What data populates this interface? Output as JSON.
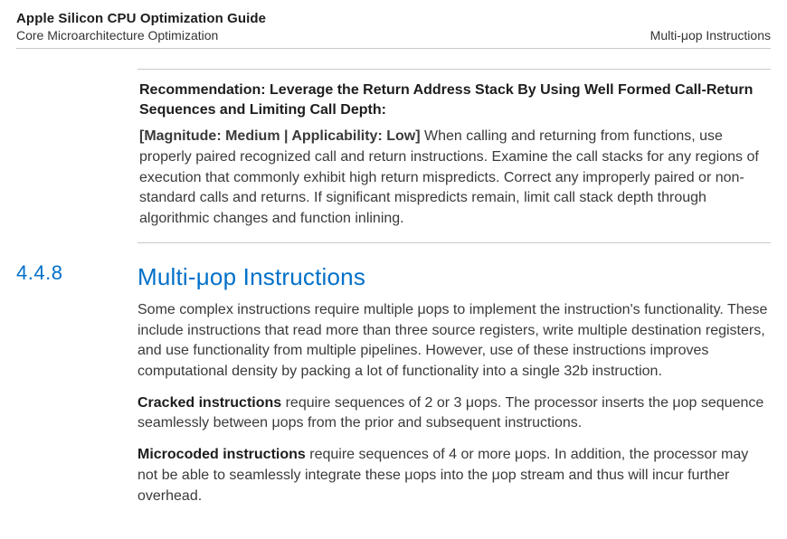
{
  "header": {
    "doc_title": "Apple Silicon CPU Optimization Guide",
    "left_crumb": "Core Microarchitecture Optimization",
    "right_crumb": "Multi-μop Instructions"
  },
  "callout": {
    "label": "Recommendation: ",
    "title": "Leverage the Return Address Stack By Using Well Formed Call-Return Sequences and Limiting Call Depth:",
    "tag": "[Magnitude: Medium | Applicability: Low]",
    "body": " When calling and returning from functions, use properly paired recognized call and return instructions. Examine the call stacks for any regions of execution that commonly exhibit high return mispredicts. Correct any improperly paired or non-standard calls and returns. If significant mispredicts remain, limit call stack depth through algorithmic changes and function inlining."
  },
  "section": {
    "number": "4.4.8",
    "title": "Multi-μop Instructions",
    "intro": "Some complex instructions require multiple μops to implement the instruction's functionality. These include instructions that read more than three source registers, write multiple destination registers, and use functionality from multiple pipelines. However, use of these instructions improves computational density by packing a lot of functionality into a single 32b instruction.",
    "cracked_term": "Cracked instructions",
    "cracked_body": " require sequences of 2 or 3 μops. The processor inserts the μop sequence seamlessly between μops from the prior and subsequent instructions.",
    "micro_term": "Microcoded instructions",
    "micro_body": " require sequences of 4 or more μops. In addition, the processor may not be able to seamlessly integrate these μops into the μop stream and thus will incur further overhead."
  }
}
